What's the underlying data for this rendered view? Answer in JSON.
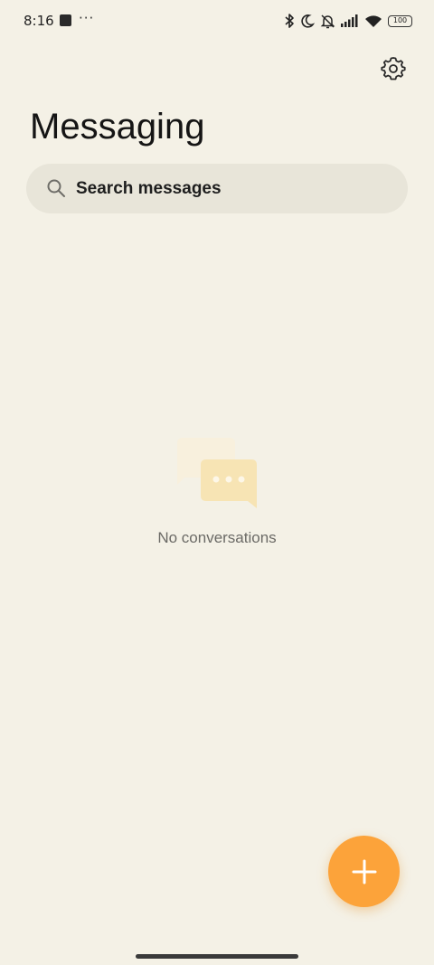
{
  "status_bar": {
    "time": "8:16",
    "more": "···",
    "battery": "100",
    "icons": [
      "bluetooth-icon",
      "moon-icon",
      "bell-off-icon",
      "signal-icon",
      "wifi-icon",
      "battery-icon"
    ]
  },
  "header": {
    "title": "Messaging",
    "settings_icon": "gear-icon"
  },
  "search": {
    "placeholder": "Search messages",
    "icon": "search-icon"
  },
  "empty_state": {
    "message": "No conversations",
    "illustration": "chat-bubbles-icon"
  },
  "fab": {
    "icon": "plus-icon",
    "color": "#fca33a"
  },
  "colors": {
    "background": "#f4f1e6",
    "search_background": "#e8e5d9",
    "accent": "#fca33a"
  }
}
